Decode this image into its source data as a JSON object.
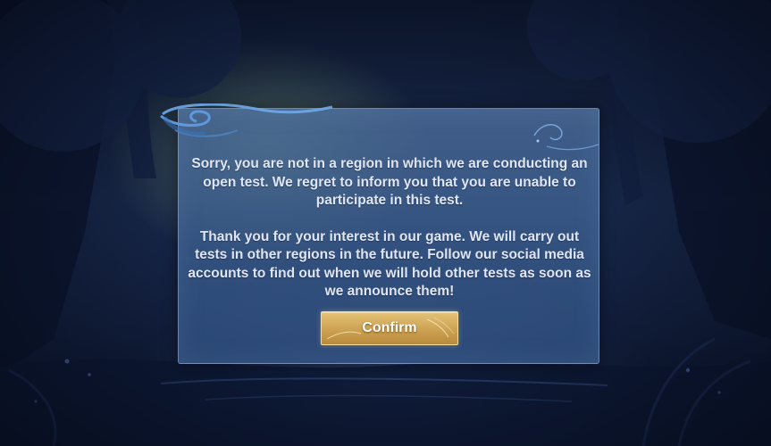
{
  "dialog": {
    "paragraphs": [
      "Sorry, you are not in a region in which we are conducting an open test. We regret to inform you that you are unable to participate in this test.",
      "Thank you for your interest in our game. We will carry out tests in other regions in the future. Follow our social media accounts to find out when we will hold other tests as soon as we announce them!"
    ],
    "confirm_label": "Confirm"
  },
  "colors": {
    "panel": "#4e709e",
    "panel_border": "#96b9e1",
    "text": "#dfe6f2",
    "button_gold": "#cfa555"
  }
}
